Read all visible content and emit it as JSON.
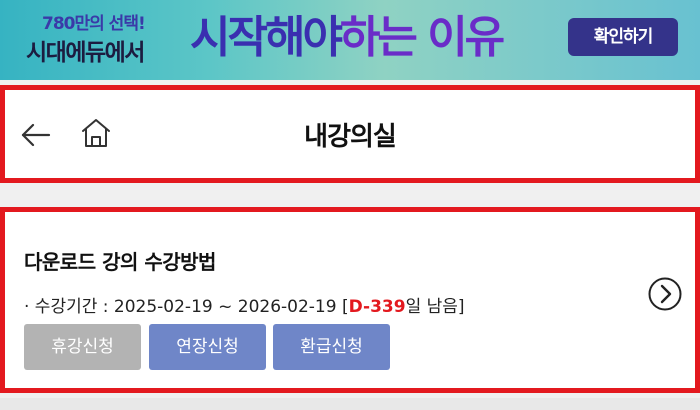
{
  "banner": {
    "pre_line1": "780만의 선택!",
    "pre_line2": "시대에듀에서",
    "headline_part1": "시작해야",
    "headline_part2": "하는 이유",
    "confirm_label": "확인하기",
    "bg_colors": [
      "#36b3c2",
      "#8fd2c3"
    ],
    "headline_color": "#3a2fb0"
  },
  "header": {
    "title": "내강의실",
    "back_icon": "arrow-left-icon",
    "home_icon": "home-icon",
    "border_color": "#e3191f"
  },
  "course": {
    "title": "다운로드 강의 수강방법",
    "period_prefix": "· 수강기간 : 2025-02-19 ~ 2026-02-19 [",
    "dday": "D-339",
    "period_suffix": "일 남음]",
    "buttons": {
      "leave": "휴강신청",
      "extend": "연장신청",
      "refund": "환급신청"
    },
    "next_icon": "chevron-right-circle-icon",
    "accent_color": "#e3191f",
    "button_color": "#6f86c8",
    "disabled_button_color": "#b3b3b3"
  }
}
